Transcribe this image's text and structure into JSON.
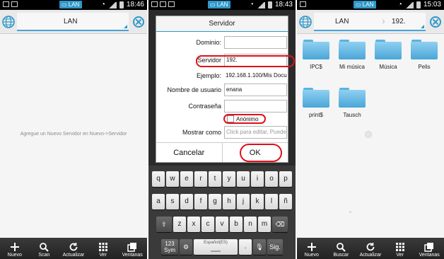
{
  "status": {
    "lan_badge": "LAN",
    "panel1_time": "18:46",
    "panel2_time": "18:43",
    "panel3_time": "15:03"
  },
  "panel1": {
    "breadcrumb": "LAN",
    "empty_message": "Agregue un Nuevo Servidor en Nuevo->Servidor"
  },
  "panel2": {
    "dialog_title": "Servidor",
    "fields": {
      "dominio": {
        "label": "Dominio:",
        "value": ""
      },
      "servidor": {
        "label": "Servidor",
        "value": "192."
      },
      "ejemplo": {
        "label": "Ejemplo:",
        "value": "192.168.1.100/Mis Docu"
      },
      "usuario": {
        "label": "Nombre de usuario",
        "value": "enana"
      },
      "contrasena": {
        "label": "Contraseña",
        "value": ""
      },
      "anonimo": {
        "label": "Anónimo"
      },
      "mostrar": {
        "label": "Mostrar como",
        "placeholder": "Click para editar, Puede"
      }
    },
    "cancel_label": "Cancelar",
    "ok_label": "OK",
    "keyboard": {
      "row1": [
        "q",
        "w",
        "e",
        "r",
        "t",
        "y",
        "u",
        "i",
        "o",
        "p"
      ],
      "row2": [
        "a",
        "s",
        "d",
        "f",
        "g",
        "h",
        "j",
        "k",
        "l",
        "ñ"
      ],
      "row3": [
        "z",
        "x",
        "c",
        "v",
        "b",
        "n",
        "m"
      ],
      "sym_top": "123",
      "sym_bottom": "Sym",
      "space_label": "Español(ES)",
      "dot_label": ".",
      "go_label": "Sig."
    }
  },
  "panel3": {
    "breadcrumb_root": "LAN",
    "breadcrumb_current": "192.",
    "files": [
      {
        "name": "IPC$"
      },
      {
        "name": "Mi música"
      },
      {
        "name": "Música"
      },
      {
        "name": "Pelis"
      },
      {
        "name": "print$"
      },
      {
        "name": "Tausch"
      }
    ]
  },
  "bottombar": {
    "panel1": [
      "Nuevo",
      "Scan",
      "Actualizar",
      "Ver",
      "Ventanas"
    ],
    "panel3": [
      "Nuevo",
      "Buscar",
      "Actualizar",
      "Ver",
      "Ventanas"
    ]
  },
  "colors": {
    "accent": "#2f98c9",
    "highlight": "#e0101a",
    "folder": "#6cbce6"
  }
}
